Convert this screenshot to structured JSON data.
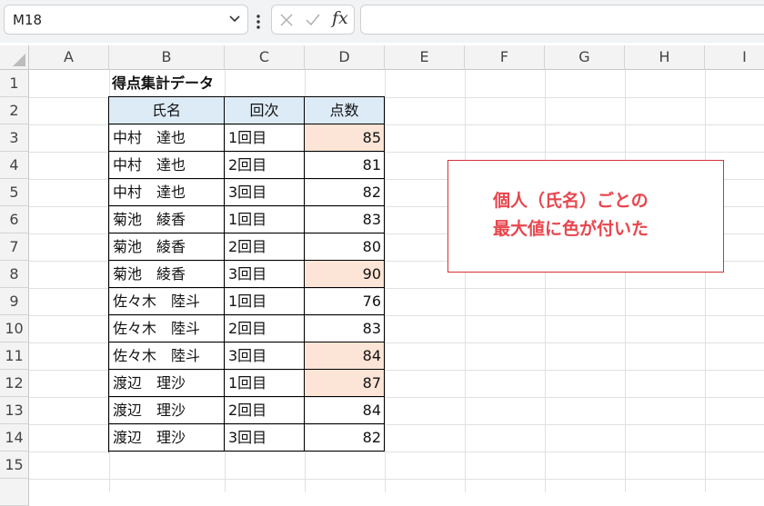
{
  "formula_bar": {
    "name_box": "M18",
    "fx_label": "fx",
    "formula": ""
  },
  "columns": [
    "A",
    "B",
    "C",
    "D",
    "E",
    "F",
    "G",
    "H",
    "I"
  ],
  "rows": [
    "1",
    "2",
    "3",
    "4",
    "5",
    "6",
    "7",
    "8",
    "9",
    "10",
    "11",
    "12",
    "13",
    "14",
    "15"
  ],
  "sheet": {
    "title": "得点集計データ",
    "headers": [
      "氏名",
      "回次",
      "点数"
    ],
    "records": [
      {
        "name": "中村　達也",
        "round": "1回目",
        "score": "85"
      },
      {
        "name": "中村　達也",
        "round": "2回目",
        "score": "81"
      },
      {
        "name": "中村　達也",
        "round": "3回目",
        "score": "82"
      },
      {
        "name": "菊池　綾香",
        "round": "1回目",
        "score": "83"
      },
      {
        "name": "菊池　綾香",
        "round": "2回目",
        "score": "80"
      },
      {
        "name": "菊池　綾香",
        "round": "3回目",
        "score": "90"
      },
      {
        "name": "佐々木　陸斗",
        "round": "1回目",
        "score": "76"
      },
      {
        "name": "佐々木　陸斗",
        "round": "2回目",
        "score": "83"
      },
      {
        "name": "佐々木　陸斗",
        "round": "3回目",
        "score": "84"
      },
      {
        "name": "渡辺　理沙",
        "round": "1回目",
        "score": "87"
      },
      {
        "name": "渡辺　理沙",
        "round": "2回目",
        "score": "84"
      },
      {
        "name": "渡辺　理沙",
        "round": "3回目",
        "score": "82"
      }
    ],
    "highlighted_score_rows": [
      0,
      5,
      8,
      9
    ],
    "highlight_color": "#fce4d6",
    "header_fill": "#ddebf7"
  },
  "note": {
    "line1": "個人（氏名）ごとの",
    "line2": "最大値に色が付いた",
    "border_color": "#d13438",
    "text_color": "#e8464e"
  }
}
